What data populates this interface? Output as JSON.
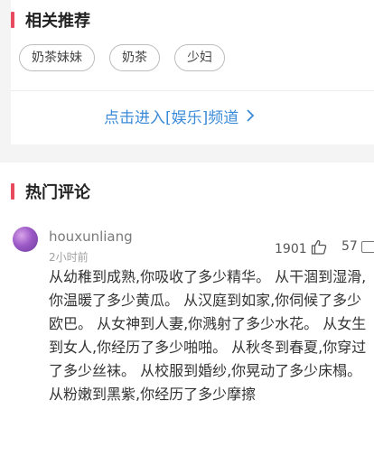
{
  "related": {
    "title": "相关推荐",
    "tags": [
      "奶茶妹妹",
      "奶茶",
      "少妇"
    ],
    "more_link": "点击进入[娱乐]频道"
  },
  "hot_comments": {
    "title": "热门评论",
    "comment": {
      "username": "houxunliang",
      "time": "2小时前",
      "likes": "1901",
      "replies": "57",
      "text": "从幼稚到成熟,你吸收了多少精华。 从干涸到湿滑,你温暖了多少黄瓜。 从汉庭到如家,你伺候了多少欧巴。 从女神到人妻,你溅射了多少水花。 从女生到女人,你经历了多少啪啪。 从秋冬到春夏,你穿过了多少丝袜。 从校服到婚纱,你晃动了多少床榻。 从粉嫩到黑紫,你经历了多少摩擦"
    }
  },
  "colors": {
    "accent_bar": "#e84a5f",
    "link": "#3b8bd9"
  },
  "icons": [
    "thumb-up-icon",
    "comment-icon",
    "chevron-right-icon"
  ]
}
